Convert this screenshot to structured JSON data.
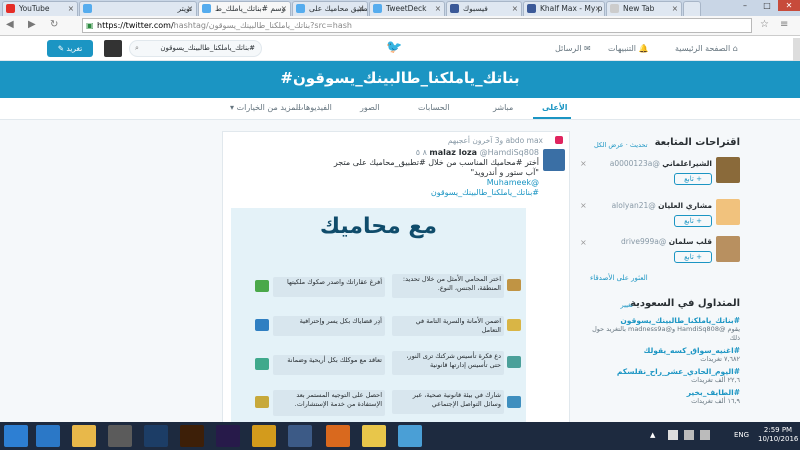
{
  "browser": {
    "tabs": [
      {
        "label": "YouTube",
        "color": "#e52d27"
      },
      {
        "label": "تويتر",
        "color": "#55acee"
      },
      {
        "label": "وسم #بناتك_ياملك_ط",
        "color": "#55acee"
      },
      {
        "label": "تطبيق محاميك على",
        "color": "#55acee"
      },
      {
        "label": "TweetDeck",
        "color": "#55acee"
      },
      {
        "label": "فيسبوك",
        "color": "#3b5998"
      },
      {
        "label": "Khalf Max - My p",
        "color": "#3b5998"
      },
      {
        "label": "New Tab",
        "color": "#cccccc"
      }
    ],
    "url_scheme": "https://twitter.com/",
    "url_rest": "hashtag/بناتك_ياملكنا_طالبينك_يسوقون?src=hash"
  },
  "header": {
    "home": "الصفحة الرئيسية",
    "notifications": "التنبيهات",
    "messages": "الرسائل",
    "search_value": "#بناتك_ياملكنا_طالبينك_يسوقون",
    "tweet_button": "تغريد"
  },
  "banner": {
    "title": "#بناتك_ياملكنا_طالبينك_يسوقون"
  },
  "subnav": {
    "items": [
      "الأعلى",
      "مباشر",
      "الحسابات",
      "الصور",
      "الفيديوهات",
      "المزيد من الخيارات"
    ]
  },
  "tweet": {
    "retweet_line": "abdo max و3 آخرون أعجبهم",
    "author": "malaz loza",
    "handle": "@HamdiSq808",
    "time": "٨ ٥",
    "line1": "أختر #محاميك المناسب من خلال #تطبيق_محاميك على متجر",
    "line2": "\"آب ستور و أندرويد\"",
    "line3": "@Muhameek",
    "hashtag": "#بناتك_ياملكنا_طالبينك_يسوقون",
    "image_title": "مع محاميك",
    "cards_left": [
      "أفرغ عقاراتك واصدر صكوك ملكيتها",
      "أدِر قضاياك بكل يسر وإحترافية",
      "تعاقد مع موكلك بكل أريحية وضمانة",
      "احصل على التوجيه المستمر بعد الإستفادة من خدمة الإستشارات."
    ],
    "cards_right": [
      "اختر المحامي الأمثل من خلال تحديد: المنطقة، الجنس، النوع.",
      "اضمن الأمانة والسرية التامة في التعامل",
      "دع فكرة تأسيس شركتك ترى النور، حتى تأسيس إدارتها قانونية",
      "شارك في بيئة قانونية صحية، عبر وسائل التواصل الإجتماعي"
    ]
  },
  "sidebar": {
    "follow_title": "اقتراحات المتابعة",
    "refresh": "تحديث",
    "view_all": "عرض الكل",
    "users": [
      {
        "name": "الشيراعلماني",
        "handle": "@a0000123a",
        "follow": "تابع"
      },
      {
        "name": "مشاري العليان",
        "handle": "@alolyan21",
        "follow": "تابع"
      },
      {
        "name": "قلب سلمان",
        "handle": "@drive999a",
        "follow": "تابع"
      }
    ],
    "find_friends": "العثور على الأصدقاء",
    "trends_title": "المتداول في السعودية",
    "change": "تغيير",
    "trends": [
      {
        "tag": "#بناتك_ياملكنا_طالبينك_يسوقون",
        "desc": "يقوم @HamdiSq808 و@madness9a بالتغريد حول ذلك"
      },
      {
        "tag": "#اغنيه_سواق_كسه_يقولك",
        "desc": "٧,٦٨٢ تغريدات"
      },
      {
        "tag": "#اليوم_الحادي_عشر_راح_نقلسكم",
        "desc": "٢٢,٦ ألف تغريدات"
      },
      {
        "tag": "#الطايف_بخير",
        "desc": "١٦,٩ ألف تغريدات"
      }
    ]
  },
  "taskbar": {
    "lang": "ENG",
    "time": "2:59 PM",
    "date": "10/10/2016"
  }
}
